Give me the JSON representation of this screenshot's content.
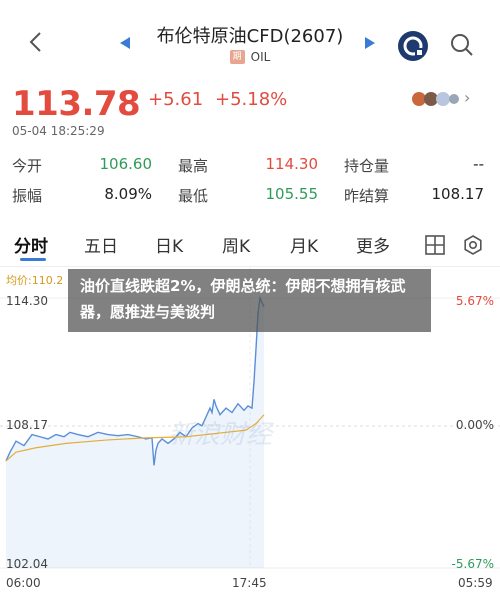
{
  "header": {
    "title": "布伦特原油CFD(2607)",
    "badge": "期",
    "subtitle": "OIL"
  },
  "quote": {
    "price": "113.78",
    "change": "+5.61",
    "change_pct": "+5.18%",
    "timestamp": "05-04 18:25:29"
  },
  "stats": {
    "open_label": "今开",
    "open_value": "106.60",
    "high_label": "最高",
    "high_value": "114.30",
    "oi_label": "持仓量",
    "oi_value": "--",
    "amp_label": "振幅",
    "amp_value": "8.09%",
    "low_label": "最低",
    "low_value": "105.55",
    "prev_label": "昨结算",
    "prev_value": "108.17"
  },
  "tabs": [
    {
      "label": "分时"
    },
    {
      "label": "五日"
    },
    {
      "label": "日K"
    },
    {
      "label": "周K"
    },
    {
      "label": "月K"
    },
    {
      "label": "更多"
    }
  ],
  "chart_overlay_left": "均价:110.2",
  "banner": {
    "text": "油价直线跌超2%，伊朗总统：伊朗不想拥有核武器，愿推进与美谈判"
  },
  "chart_data": {
    "type": "line",
    "y_left_ticks": [
      "114.30",
      "108.17",
      "102.04"
    ],
    "y_right_ticks": [
      "5.67%",
      "0.00%",
      "-5.67%"
    ],
    "x_ticks": [
      "06:00",
      "17:45",
      "05:59"
    ],
    "ylim": [
      102.04,
      114.3
    ],
    "reference": 108.17,
    "colors": {
      "price": "#5a8fd8",
      "average": "#e3ae3c",
      "up": "#e34b3f",
      "down": "#2f9b5a"
    }
  }
}
